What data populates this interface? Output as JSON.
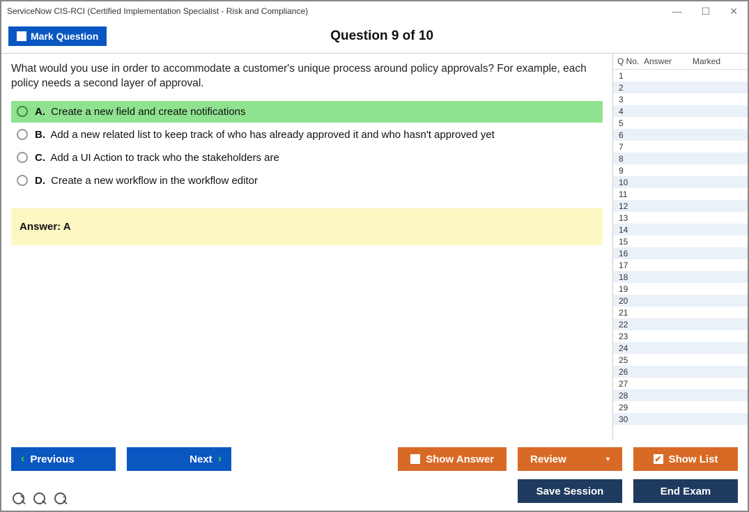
{
  "window": {
    "title": "ServiceNow CIS-RCI (Certified Implementation Specialist - Risk and Compliance)"
  },
  "header": {
    "mark_label": "Mark Question",
    "counter": "Question 9 of 10"
  },
  "question": {
    "text": "What would you use in order to accommodate a customer's unique process around policy approvals? For example, each policy needs a second layer of approval.",
    "options": [
      {
        "letter": "A.",
        "text": "Create a new field and create notifications",
        "highlighted": true
      },
      {
        "letter": "B.",
        "text": "Add a new related list to keep track of who has already approved it and who hasn't approved yet",
        "highlighted": false
      },
      {
        "letter": "C.",
        "text": "Add a UI Action to track who the stakeholders are",
        "highlighted": false
      },
      {
        "letter": "D.",
        "text": "Create a new workflow in the workflow editor",
        "highlighted": false
      }
    ],
    "answer_label": "Answer: A"
  },
  "sidepanel": {
    "col1": "Q No.",
    "col2": "Answer",
    "col3": "Marked",
    "rows": [
      1,
      2,
      3,
      4,
      5,
      6,
      7,
      8,
      9,
      10,
      11,
      12,
      13,
      14,
      15,
      16,
      17,
      18,
      19,
      20,
      21,
      22,
      23,
      24,
      25,
      26,
      27,
      28,
      29,
      30
    ]
  },
  "buttons": {
    "previous": "Previous",
    "next": "Next",
    "show_answer": "Show Answer",
    "review": "Review",
    "show_list": "Show List",
    "save_session": "Save Session",
    "end_exam": "End Exam"
  }
}
